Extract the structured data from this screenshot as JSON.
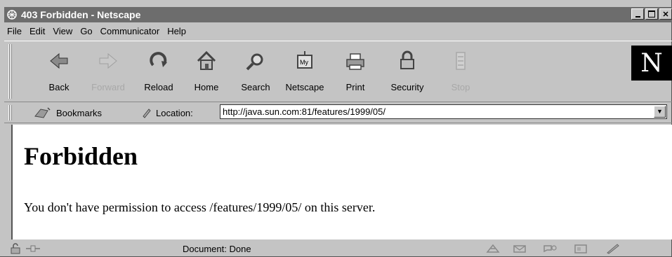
{
  "window": {
    "title": "403 Forbidden - Netscape"
  },
  "menu": [
    "File",
    "Edit",
    "View",
    "Go",
    "Communicator",
    "Help"
  ],
  "toolbar": {
    "buttons": [
      {
        "label": "Back",
        "icon": "back-arrow-icon",
        "enabled": true
      },
      {
        "label": "Forward",
        "icon": "forward-arrow-icon",
        "enabled": false
      },
      {
        "label": "Reload",
        "icon": "reload-icon",
        "enabled": true
      },
      {
        "label": "Home",
        "icon": "home-icon",
        "enabled": true
      },
      {
        "label": "Search",
        "icon": "search-icon",
        "enabled": true
      },
      {
        "label": "Netscape",
        "icon": "netscape-icon",
        "enabled": true
      },
      {
        "label": "Print",
        "icon": "printer-icon",
        "enabled": true
      },
      {
        "label": "Security",
        "icon": "lock-icon",
        "enabled": true
      },
      {
        "label": "Stop",
        "icon": "stop-icon",
        "enabled": false
      }
    ],
    "logo": "N"
  },
  "location_bar": {
    "bookmarks_label": "Bookmarks",
    "location_label": "Location:",
    "url": "http://java.sun.com:81/features/1999/05/"
  },
  "page": {
    "heading": "Forbidden",
    "message": "You don't have permission to access /features/1999/05/ on this server."
  },
  "status": {
    "text": "Document: Done"
  },
  "colors": {
    "chrome": "#c4c4c4",
    "titlebar": "#6d6d6d",
    "content_bg": "#ffffff"
  }
}
